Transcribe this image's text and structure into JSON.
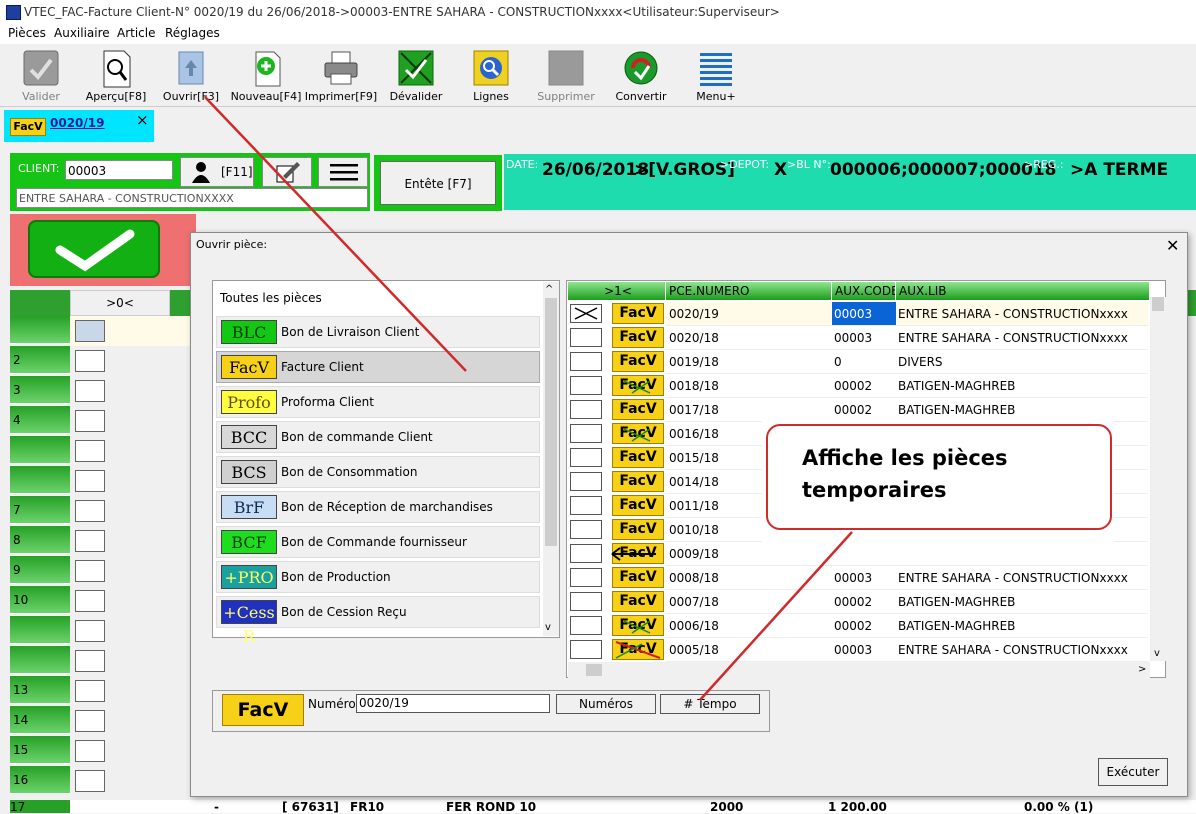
{
  "window": {
    "title": "VTEC_FAC-Facture Client-N° 0020/19 du 26/06/2018->00003-ENTRE SAHARA - CONSTRUCTIONxxxx<Utilisateur:Superviseur>"
  },
  "menu": [
    "Pièces",
    "Auxiliaire",
    "Article",
    "Réglages"
  ],
  "toolbar": [
    {
      "label": "Valider",
      "icon": "validate-icon",
      "disabled": true
    },
    {
      "label": "Aperçu[F8]",
      "icon": "preview-icon",
      "disabled": false
    },
    {
      "label": "Ouvrir[F3]",
      "icon": "open-icon",
      "disabled": false
    },
    {
      "label": "Nouveau[F4]",
      "icon": "new-icon",
      "disabled": false
    },
    {
      "label": "Imprimer[F9]",
      "icon": "printer-icon",
      "disabled": false
    },
    {
      "label": "Dévalider",
      "icon": "unvalidate-icon",
      "disabled": false
    },
    {
      "label": "Lignes",
      "icon": "lines-icon",
      "disabled": false
    },
    {
      "label": "Supprimer",
      "icon": "delete-icon",
      "disabled": true
    },
    {
      "label": "Convertir",
      "icon": "convert-icon",
      "disabled": false
    },
    {
      "label": "Menu+",
      "icon": "menu-icon",
      "disabled": false
    }
  ],
  "doc_tab": {
    "badge": "FacV",
    "number": "0020/19",
    "close": "×"
  },
  "client": {
    "label": "CLIENT:",
    "code": "00003",
    "name": "ENTRE SAHARA - CONSTRUCTIONXXXX",
    "f11": "[F11]"
  },
  "entete": {
    "label": "Entête [F7]"
  },
  "info": {
    "date_label": "DATE:",
    "date": "26/06/2018",
    "type": ">[V.GROS]",
    "depot_label": ">DEPOT:",
    "depot": "X",
    "bl_label": ">BL N°:",
    "bl": "000006;000007;000018",
    "reg_label": ">REG.:",
    "reg": ">A TERME"
  },
  "bg_grid": {
    "header": ">0<",
    "row_numbers": [
      "",
      "2",
      "3",
      "4",
      "",
      "",
      "7",
      "8",
      "9",
      "10",
      "",
      "",
      "13",
      "14",
      "15",
      "16",
      "17"
    ],
    "footer_cells": [
      "-",
      "[ 67631]",
      "FR10",
      "FER ROND 10",
      "2000",
      "1 200.00",
      "0.00 % (1)"
    ]
  },
  "dialog": {
    "title": "Ouvrir pièce:",
    "close": "✕",
    "list_header": "Toutes les pièces",
    "doc_types": [
      {
        "badge": "BLC",
        "label": "Bon de Livraison Client",
        "bg": "#12c812",
        "fg": "#0a3a0a"
      },
      {
        "badge": "FacV",
        "label": "Facture Client",
        "bg": "#f7d117",
        "fg": "#000000",
        "selected": true
      },
      {
        "badge": "Profo",
        "label": "Proforma Client",
        "bg": "#ffff40",
        "fg": "#6a4b00"
      },
      {
        "badge": "BCC",
        "label": "Bon de commande Client",
        "bg": "#d8d8d8",
        "fg": "#000000"
      },
      {
        "badge": "BCS",
        "label": "Bon de Consommation",
        "bg": "#d0d0d0",
        "fg": "#000000"
      },
      {
        "badge": "BrF",
        "label": "Bon de Réception de marchandises",
        "bg": "#c8dcf5",
        "fg": "#102a50"
      },
      {
        "badge": "BCF",
        "label": "Bon de Commande fournisseur",
        "bg": "#1edc1e",
        "fg": "#0a3a0a"
      },
      {
        "badge": "+PRO",
        "label": "Bon de Production",
        "bg": "#1aa0a0",
        "fg": "#ffff60"
      },
      {
        "badge": "+Cess R",
        "label": "Bon de Cession Reçu",
        "bg": "#2030c0",
        "fg": "#ffff60"
      }
    ],
    "grid_headers": [
      ">1<",
      "",
      "PCE.NUMERO",
      "AUX.CODE",
      "AUX.LIB"
    ],
    "rows": [
      {
        "num": "0020/19",
        "code": "00003",
        "lib": "ENTRE SAHARA - CONSTRUCTIONxxxx",
        "mark": "checked",
        "badge": "FacV",
        "status": "normal"
      },
      {
        "num": "0020/18",
        "code": "00003",
        "lib": "ENTRE SAHARA - CONSTRUCTIONxxxx",
        "mark": "",
        "badge": "FacV",
        "status": "normal"
      },
      {
        "num": "0019/18",
        "code": "0",
        "lib": "DIVERS",
        "mark": "",
        "badge": "FacV",
        "status": "normal"
      },
      {
        "num": "0018/18",
        "code": "00002",
        "lib": "BATIGEN-MAGHREB",
        "mark": "",
        "badge": "FacV",
        "status": "validated"
      },
      {
        "num": "0017/18",
        "code": "00002",
        "lib": "BATIGEN-MAGHREB",
        "mark": "",
        "badge": "FacV",
        "status": "normal"
      },
      {
        "num": "0016/18",
        "code": "",
        "lib": "",
        "mark": "",
        "badge": "FacV",
        "status": "validated"
      },
      {
        "num": "0015/18",
        "code": "",
        "lib": "",
        "mark": "",
        "badge": "FacV",
        "status": "normal"
      },
      {
        "num": "0014/18",
        "code": "",
        "lib": "",
        "mark": "",
        "badge": "FacV",
        "status": "normal"
      },
      {
        "num": "0011/18",
        "code": "",
        "lib": "",
        "mark": "",
        "badge": "FacV",
        "status": "normal"
      },
      {
        "num": "0010/18",
        "code": "",
        "lib": "",
        "mark": "",
        "badge": "FacV",
        "status": "normal"
      },
      {
        "num": "0009/18",
        "code": "",
        "lib": "",
        "mark": "",
        "badge": "FacV",
        "status": "arrow"
      },
      {
        "num": "0008/18",
        "code": "00003",
        "lib": "ENTRE SAHARA - CONSTRUCTIONxxxx",
        "mark": "",
        "badge": "FacV",
        "status": "normal"
      },
      {
        "num": "0007/18",
        "code": "00002",
        "lib": "BATIGEN-MAGHREB",
        "mark": "",
        "badge": "FacV",
        "status": "normal"
      },
      {
        "num": "0006/18",
        "code": "00002",
        "lib": "BATIGEN-MAGHREB",
        "mark": "",
        "badge": "FacV",
        "status": "validated"
      },
      {
        "num": "0005/18",
        "code": "00003",
        "lib": "ENTRE SAHARA - CONSTRUCTIONxxxx",
        "mark": "",
        "badge": "FacV",
        "status": "crossed"
      }
    ],
    "bottom": {
      "badge": "FacV",
      "numero_label": "Numéro:",
      "numero_value": "0020/19",
      "numeros_btn": "Numéros",
      "tempo_btn": "# Tempo",
      "execute_btn": "Exécuter"
    }
  },
  "annotation": {
    "callout_line1": "Affiche les pièces",
    "callout_line2": "temporaires",
    "color": "#d02a2a"
  },
  "colors": {
    "green": "#16c416",
    "teal": "#1fdcae",
    "cyan_tab": "#00e5ff",
    "facv_yellow": "#f7d117",
    "salmon": "#ee7070"
  }
}
